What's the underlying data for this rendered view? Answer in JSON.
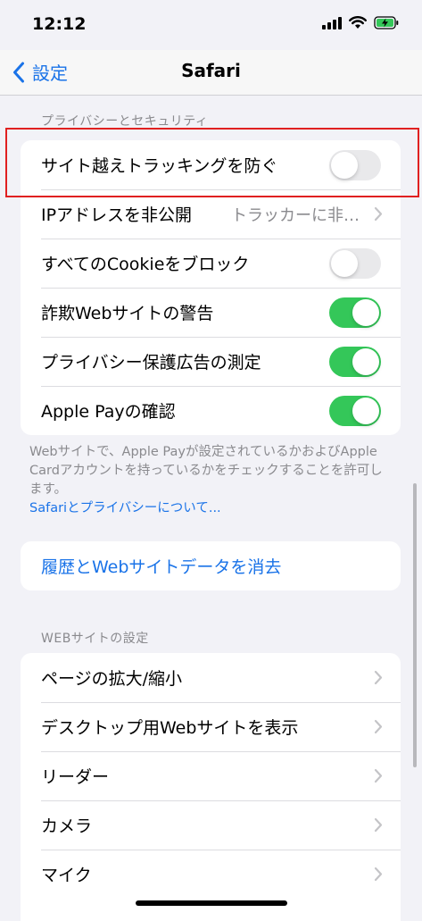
{
  "status": {
    "time": "12:12"
  },
  "nav": {
    "back_label": "設定",
    "title": "Safari"
  },
  "privacy": {
    "header": "プライバシーとセキュリティ",
    "rows": [
      {
        "label": "サイト越えトラッキングを防ぐ",
        "toggle": false
      },
      {
        "label": "IPアドレスを非公開",
        "detail": "トラッカーに非…"
      },
      {
        "label": "すべてのCookieをブロック",
        "toggle": false
      },
      {
        "label": "詐欺Webサイトの警告",
        "toggle": true
      },
      {
        "label": "プライバシー保護広告の測定",
        "toggle": true
      },
      {
        "label": "Apple Payの確認",
        "toggle": true
      }
    ],
    "footer": "Webサイトで、Apple Payが設定されているかおよびApple Cardアカウントを持っているかをチェックすることを許可します。",
    "footer_link": "Safariとプライバシーについて..."
  },
  "clear": {
    "label": "履歴とWebサイトデータを消去"
  },
  "website_settings": {
    "header": "WEBサイトの設定",
    "rows": [
      {
        "label": "ページの拡大/縮小"
      },
      {
        "label": "デスクトップ用Webサイトを表示"
      },
      {
        "label": "リーダー"
      },
      {
        "label": "カメラ"
      },
      {
        "label": "マイク"
      }
    ]
  },
  "colors": {
    "accent": "#1a73e8",
    "toggle_on": "#34c759",
    "highlight": "#e02020"
  }
}
